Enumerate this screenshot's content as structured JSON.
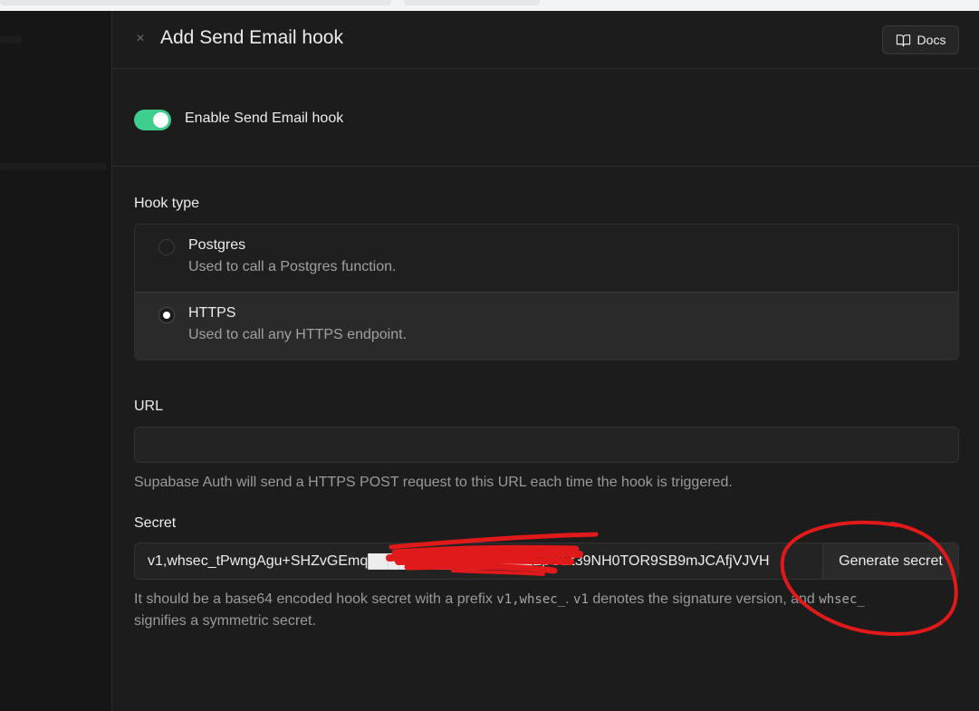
{
  "header": {
    "title": "Add Send Email hook",
    "close_symbol": "×",
    "docs_label": "Docs",
    "docs_icon": "book-open-icon"
  },
  "enable": {
    "label": "Enable Send Email hook",
    "enabled": true,
    "accent_color": "#3ecf8e"
  },
  "hook_type": {
    "label": "Hook type",
    "options": [
      {
        "title": "Postgres",
        "description": "Used to call a Postgres function.",
        "selected": false
      },
      {
        "title": "HTTPS",
        "description": "Used to call any HTTPS endpoint.",
        "selected": true
      }
    ]
  },
  "url": {
    "label": "URL",
    "value": "",
    "help": "Supabase Auth will send a HTTPS POST request to this URL each time the hook is triggered."
  },
  "secret": {
    "label": "Secret",
    "value": "v1,whsec_tPwngAgu+SHZvGEmq████████████████EpGEt39NH0TOR9SB9mJCAfjVJVH",
    "generate_label": "Generate secret",
    "help_part1": "It should be a base64 encoded hook secret with a prefix ",
    "help_code1": "v1,whsec_",
    "help_part2": ". ",
    "help_code2": "v1",
    "help_part3": " denotes the signature version, and ",
    "help_code3": "whsec_",
    "help_part4": " signifies a symmetric secret."
  },
  "colors": {
    "background": "#1c1c1c",
    "annotation_red": "#e0191b"
  }
}
